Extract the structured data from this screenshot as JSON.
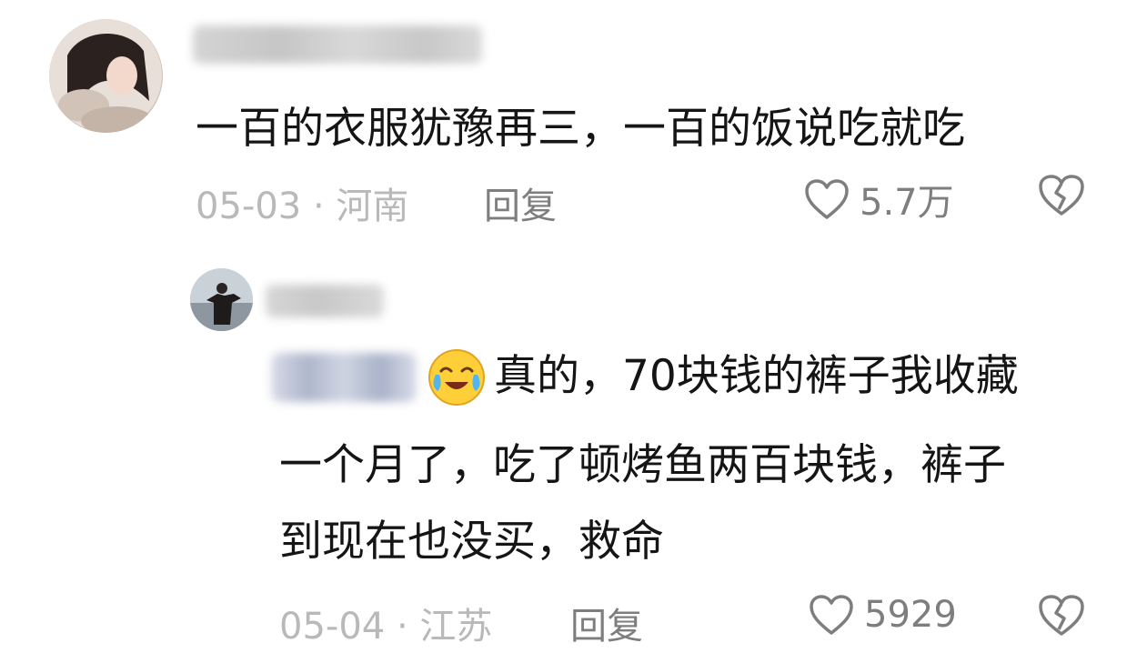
{
  "comment": {
    "avatar_icon": "user-avatar-icon",
    "text": "一百的衣服犹豫再三，一百的饭说吃就吃",
    "meta": "05-03 · 河南",
    "reply_label": "回复",
    "like_count": "5.7万"
  },
  "reply": {
    "avatar_icon": "user-avatar-icon",
    "emoji_icon": "crying-laughing-emoji-icon",
    "line1": "真的，70块钱的裤子我收藏",
    "line2": "一个月了，吃了顿烤鱼两百块钱，裤子",
    "line3": "到现在也没买，救命",
    "meta": "05-04 · 江苏",
    "reply_label": "回复",
    "like_count": "5929"
  },
  "colors": {
    "text": "#151515",
    "meta": "#b9b9b9",
    "action": "#7e7e7e"
  }
}
